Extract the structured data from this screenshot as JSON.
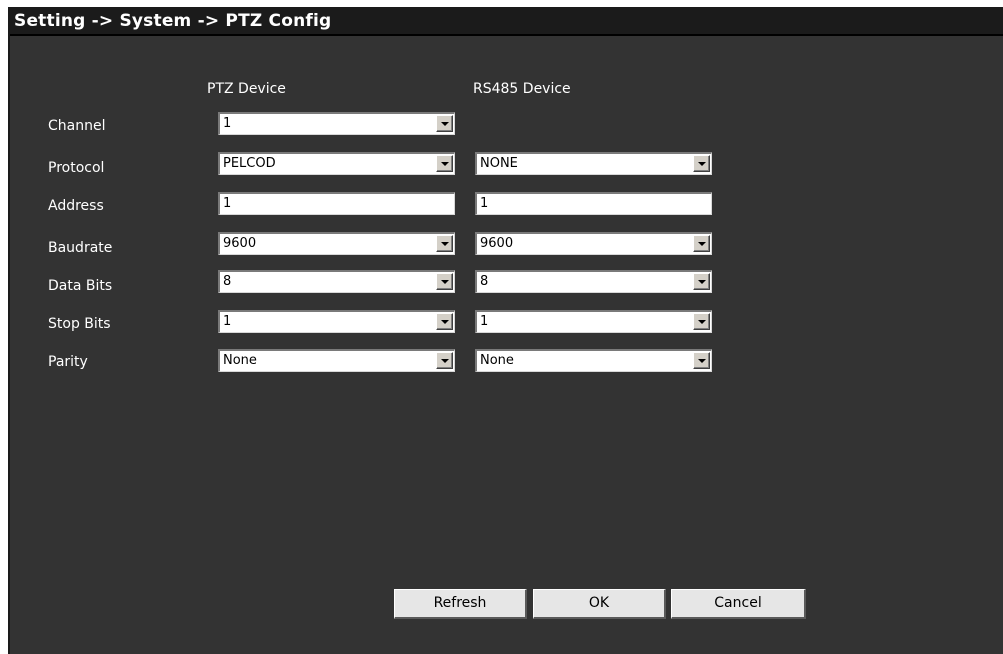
{
  "title": "Setting -> System -> PTZ Config",
  "columns": {
    "ptz": "PTZ Device",
    "rs485": "RS485 Device"
  },
  "rows": {
    "channel": {
      "label": "Channel",
      "ptz": "1"
    },
    "protocol": {
      "label": "Protocol",
      "ptz": "PELCOD",
      "rs485": "NONE"
    },
    "address": {
      "label": "Address",
      "ptz": "1",
      "rs485": "1"
    },
    "baudrate": {
      "label": "Baudrate",
      "ptz": "9600",
      "rs485": "9600"
    },
    "databits": {
      "label": "Data Bits",
      "ptz": "8",
      "rs485": "8"
    },
    "stopbits": {
      "label": "Stop Bits",
      "ptz": "1",
      "rs485": "1"
    },
    "parity": {
      "label": "Parity",
      "ptz": "None",
      "rs485": "None"
    }
  },
  "buttons": {
    "refresh": "Refresh",
    "ok": "OK",
    "cancel": "Cancel"
  },
  "icons": {
    "dropdown": "chevron-down-icon"
  }
}
